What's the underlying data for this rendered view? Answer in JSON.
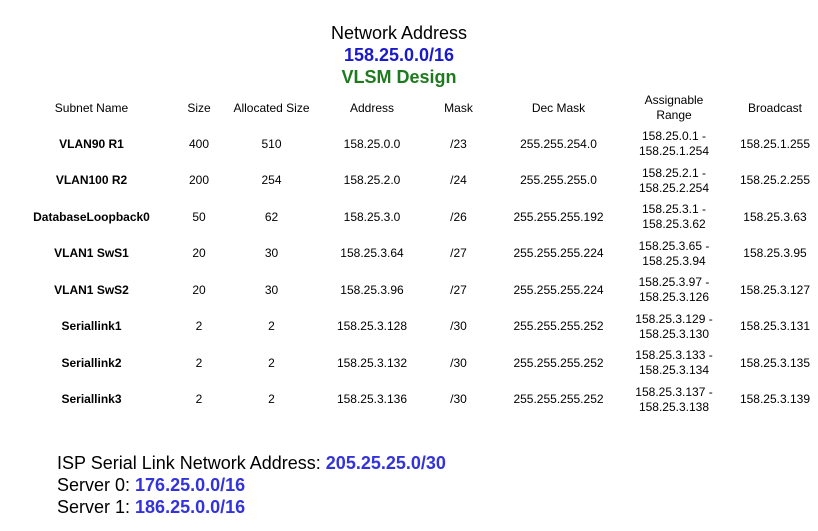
{
  "header": {
    "title": "Network Address",
    "network": "158.25.0.0/16",
    "subtitle": "VLSM Design"
  },
  "table": {
    "headers": {
      "subnet_name": "Subnet Name",
      "size": "Size",
      "allocated_size": "Allocated Size",
      "address": "Address",
      "mask": "Mask",
      "dec_mask": "Dec Mask",
      "assignable_range_1": "Assignable",
      "assignable_range_2": "Range",
      "broadcast": "Broadcast"
    },
    "rows": [
      {
        "name": "VLAN90 R1",
        "size": "400",
        "allocated": "510",
        "address": "158.25.0.0",
        "mask": "/23",
        "dec_mask": "255.255.254.0",
        "range_start": "158.25.0.1 -",
        "range_end": "158.25.1.254",
        "broadcast": "158.25.1.255"
      },
      {
        "name": "VLAN100 R2",
        "size": "200",
        "allocated": "254",
        "address": "158.25.2.0",
        "mask": "/24",
        "dec_mask": "255.255.255.0",
        "range_start": "158.25.2.1 -",
        "range_end": "158.25.2.254",
        "broadcast": "158.25.2.255"
      },
      {
        "name": "DatabaseLoopback0",
        "size": "50",
        "allocated": "62",
        "address": "158.25.3.0",
        "mask": "/26",
        "dec_mask": "255.255.255.192",
        "range_start": "158.25.3.1 -",
        "range_end": "158.25.3.62",
        "broadcast": "158.25.3.63"
      },
      {
        "name": "VLAN1 SwS1",
        "size": "20",
        "allocated": "30",
        "address": "158.25.3.64",
        "mask": "/27",
        "dec_mask": "255.255.255.224",
        "range_start": "158.25.3.65 -",
        "range_end": "158.25.3.94",
        "broadcast": "158.25.3.95"
      },
      {
        "name": "VLAN1 SwS2",
        "size": "20",
        "allocated": "30",
        "address": "158.25.3.96",
        "mask": "/27",
        "dec_mask": "255.255.255.224",
        "range_start": "158.25.3.97 -",
        "range_end": "158.25.3.126",
        "broadcast": "158.25.3.127"
      },
      {
        "name": "Seriallink1",
        "size": "2",
        "allocated": "2",
        "address": "158.25.3.128",
        "mask": "/30",
        "dec_mask": "255.255.255.252",
        "range_start": "158.25.3.129 -",
        "range_end": "158.25.3.130",
        "broadcast": "158.25.3.131"
      },
      {
        "name": "Seriallink2",
        "size": "2",
        "allocated": "2",
        "address": "158.25.3.132",
        "mask": "/30",
        "dec_mask": "255.255.255.252",
        "range_start": "158.25.3.133 -",
        "range_end": "158.25.3.134",
        "broadcast": "158.25.3.135"
      },
      {
        "name": "Seriallink3",
        "size": "2",
        "allocated": "2",
        "address": "158.25.3.136",
        "mask": "/30",
        "dec_mask": "255.255.255.252",
        "range_start": "158.25.3.137 -",
        "range_end": "158.25.3.138",
        "broadcast": "158.25.3.139"
      }
    ]
  },
  "footer": {
    "isp_label": "ISP Serial Link  Network Address: ",
    "isp_value": "205.25.25.0/30",
    "server0_label": "Server 0: ",
    "server0_value": "176.25.0.0/16",
    "server1_label": "Server 1: ",
    "server1_value": "186.25.0.0/16"
  },
  "colors": {
    "network_blue": "#1a1acc",
    "design_green": "#1f7a1f",
    "footer_value_blue": "#3333dd"
  }
}
